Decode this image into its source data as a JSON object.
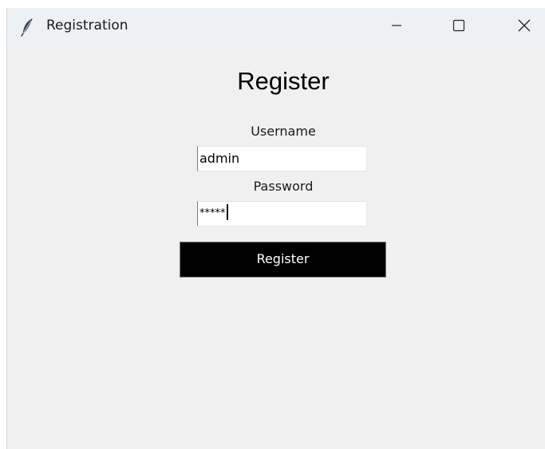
{
  "window": {
    "title": "Registration",
    "icon": "feather-icon",
    "controls": [
      "minimize-icon",
      "maximize-icon",
      "close-icon"
    ]
  },
  "form": {
    "heading": "Register",
    "username_label": "Username",
    "username_value": "admin",
    "password_label": "Password",
    "password_value": "*****",
    "submit_label": "Register"
  },
  "colors": {
    "window_background": "#f0f0f0",
    "titlebar_background": "#eef1f4",
    "button_background": "#000000",
    "button_text": "#ffffff"
  }
}
